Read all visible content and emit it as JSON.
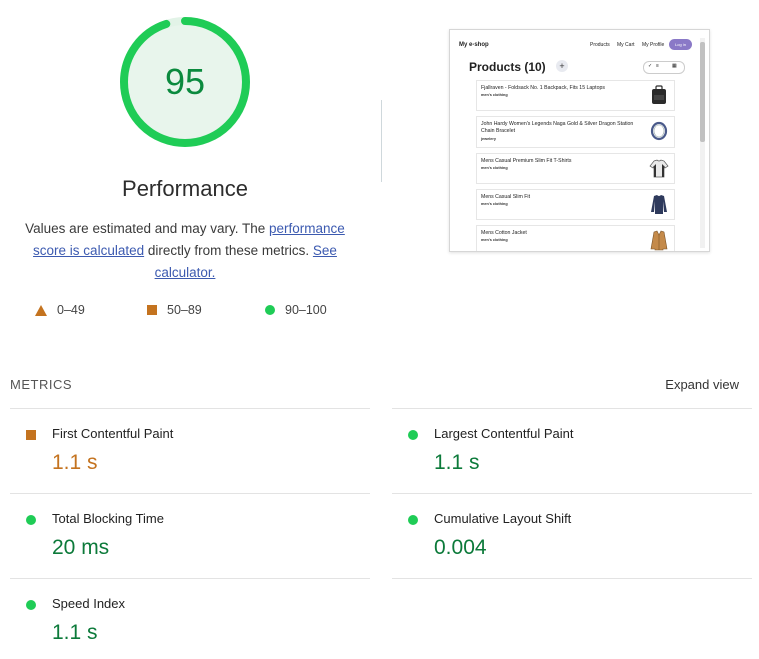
{
  "gauge": {
    "score": "95",
    "score_fraction": 0.95,
    "title": "Performance",
    "color": "#1fcc56"
  },
  "description": {
    "text_before": "Values are estimated and may vary. The ",
    "link1": "performance score is calculated",
    "text_middle": " directly from these metrics. ",
    "link2": "See calculator."
  },
  "legend": [
    {
      "shape": "triangle",
      "label": "0–49",
      "color": "#c4731f"
    },
    {
      "shape": "square",
      "label": "50–89",
      "color": "#c4731f"
    },
    {
      "shape": "circle",
      "label": "90–100",
      "color": "#1fcc56"
    }
  ],
  "preview": {
    "brand": "My e-shop",
    "nav": [
      "Products",
      "My Cart",
      "My Profile"
    ],
    "login": "Log in",
    "title": "Products (10)",
    "plus": "+",
    "products": [
      {
        "name": "Fjallraven - Foldsack No. 1 Backpack, Fits 15 Laptops",
        "category": "men's clothing",
        "icon": "backpack-icon"
      },
      {
        "name": "John Hardy Women's Legends Naga Gold & Silver Dragon Station Chain Bracelet",
        "category": "jewelery",
        "icon": "bracelet-icon"
      },
      {
        "name": "Mens Casual Premium Slim Fit T-Shirts",
        "category": "men's clothing",
        "icon": "tshirt-icon"
      },
      {
        "name": "Mens Casual Slim Fit",
        "category": "men's clothing",
        "icon": "longsleeve-icon"
      },
      {
        "name": "Mens Cotton Jacket",
        "category": "men's clothing",
        "icon": "jacket-icon"
      }
    ]
  },
  "metrics": {
    "heading": "METRICS",
    "expand_label": "Expand view",
    "items": [
      {
        "name": "First Contentful Paint",
        "value": "1.1 s",
        "status": "average"
      },
      {
        "name": "Largest Contentful Paint",
        "value": "1.1 s",
        "status": "pass"
      },
      {
        "name": "Total Blocking Time",
        "value": "20 ms",
        "status": "pass"
      },
      {
        "name": "Cumulative Layout Shift",
        "value": "0.004",
        "status": "pass"
      },
      {
        "name": "Speed Index",
        "value": "1.1 s",
        "status": "pass"
      }
    ]
  },
  "colors": {
    "pass": "#1fcc56",
    "average": "#c4731f",
    "pass_text": "#0c7a3a",
    "average_text": "#c4731f"
  }
}
